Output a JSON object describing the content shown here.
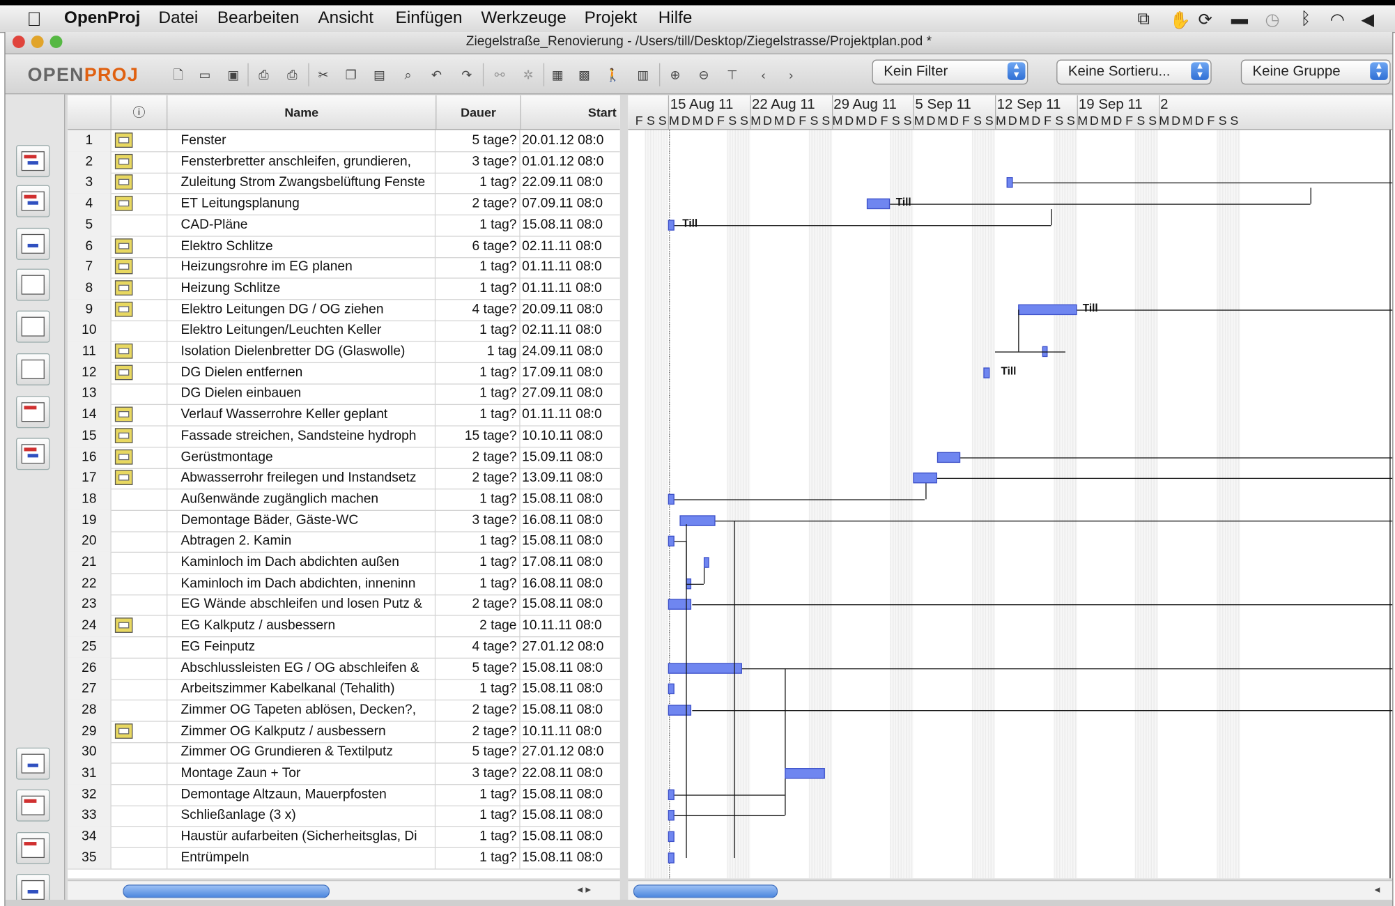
{
  "menubar": {
    "app": "OpenProj",
    "items": [
      "Datei",
      "Bearbeiten",
      "Ansicht",
      "Einfügen",
      "Werkzeuge",
      "Projekt",
      "Hilfe"
    ]
  },
  "window": {
    "title": "Ziegelstraße_Renovierung - /Users/till/Desktop/Ziegelstrasse/Projektplan.pod *"
  },
  "toolbar": {
    "logo_a": "OPEN",
    "logo_b": "PROJ",
    "filter": "Kein Filter",
    "sort": "Keine Sortieru...",
    "group": "Keine Gruppe"
  },
  "grid": {
    "columns": {
      "info": "ⓘ",
      "name": "Name",
      "duration": "Dauer",
      "start": "Start"
    },
    "rows": [
      {
        "id": "1",
        "note": true,
        "name": "Fenster",
        "duration": "5 tage?",
        "start": "20.01.12 08:0"
      },
      {
        "id": "2",
        "note": true,
        "name": "Fensterbretter anschleifen, grundieren,",
        "duration": "3 tage?",
        "start": "01.01.12 08:0"
      },
      {
        "id": "3",
        "note": true,
        "name": "Zuleitung Strom Zwangsbelüftung Fenste",
        "duration": "1 tag?",
        "start": "22.09.11 08:0"
      },
      {
        "id": "4",
        "note": true,
        "name": "ET Leitungsplanung",
        "duration": "2 tage?",
        "start": "07.09.11 08:0"
      },
      {
        "id": "5",
        "note": false,
        "name": "CAD-Pläne",
        "duration": "1 tag?",
        "start": "15.08.11 08:0"
      },
      {
        "id": "6",
        "note": true,
        "name": "Elektro Schlitze",
        "duration": "6 tage?",
        "start": "02.11.11 08:0"
      },
      {
        "id": "7",
        "note": true,
        "name": "Heizungsrohre im EG planen",
        "duration": "1 tag?",
        "start": "01.11.11 08:0"
      },
      {
        "id": "8",
        "note": true,
        "name": "Heizung Schlitze",
        "duration": "1 tag?",
        "start": "01.11.11 08:0"
      },
      {
        "id": "9",
        "note": true,
        "name": "Elektro Leitungen DG / OG ziehen",
        "duration": "4 tage?",
        "start": "20.09.11 08:0"
      },
      {
        "id": "10",
        "note": false,
        "name": "Elektro Leitungen/Leuchten Keller",
        "duration": "1 tag?",
        "start": "02.11.11 08:0"
      },
      {
        "id": "11",
        "note": true,
        "name": "Isolation Dielenbretter DG (Glaswolle)",
        "duration": "1 tag",
        "start": "24.09.11 08:0"
      },
      {
        "id": "12",
        "note": true,
        "name": "DG Dielen entfernen",
        "duration": "1 tag?",
        "start": "17.09.11 08:0"
      },
      {
        "id": "13",
        "note": false,
        "name": "DG Dielen einbauen",
        "duration": "1 tag?",
        "start": "27.09.11 08:0"
      },
      {
        "id": "14",
        "note": true,
        "name": "Verlauf Wasserrohre Keller geplant",
        "duration": "1 tag?",
        "start": "01.11.11 08:0"
      },
      {
        "id": "15",
        "note": true,
        "name": "Fassade streichen, Sandsteine hydroph",
        "duration": "15 tage?",
        "start": "10.10.11 08:0"
      },
      {
        "id": "16",
        "note": true,
        "name": "Gerüstmontage",
        "duration": "2 tage?",
        "start": "15.09.11 08:0"
      },
      {
        "id": "17",
        "note": true,
        "name": "Abwasserrohr freilegen und Instandsetz",
        "duration": "2 tage?",
        "start": "13.09.11 08:0"
      },
      {
        "id": "18",
        "note": false,
        "name": "Außenwände zugänglich machen",
        "duration": "1 tag?",
        "start": "15.08.11 08:0"
      },
      {
        "id": "19",
        "note": false,
        "name": "Demontage Bäder, Gäste-WC",
        "duration": "3 tage?",
        "start": "16.08.11 08:0"
      },
      {
        "id": "20",
        "note": false,
        "name": "Abtragen 2. Kamin",
        "duration": "1 tag?",
        "start": "15.08.11 08:0"
      },
      {
        "id": "21",
        "note": false,
        "name": "Kaminloch im Dach abdichten außen",
        "duration": "1 tag?",
        "start": "17.08.11 08:0"
      },
      {
        "id": "22",
        "note": false,
        "name": "Kaminloch im Dach abdichten, inneninn",
        "duration": "1 tag?",
        "start": "16.08.11 08:0"
      },
      {
        "id": "23",
        "note": false,
        "name": "EG Wände abschleifen und losen Putz &",
        "duration": "2 tage?",
        "start": "15.08.11 08:0"
      },
      {
        "id": "24",
        "note": true,
        "name": "EG Kalkputz / ausbessern",
        "duration": "2 tage",
        "start": "10.11.11 08:0"
      },
      {
        "id": "25",
        "note": false,
        "name": "EG Feinputz",
        "duration": "4 tage?",
        "start": "27.01.12 08:0"
      },
      {
        "id": "26",
        "note": false,
        "name": "Abschlussleisten EG / OG abschleifen &",
        "duration": "5 tage?",
        "start": "15.08.11 08:0"
      },
      {
        "id": "27",
        "note": false,
        "name": "Arbeitszimmer Kabelkanal (Tehalith)",
        "duration": "1 tag?",
        "start": "15.08.11 08:0"
      },
      {
        "id": "28",
        "note": false,
        "name": "Zimmer OG Tapeten ablösen, Decken?,",
        "duration": "2 tage?",
        "start": "15.08.11 08:0"
      },
      {
        "id": "29",
        "note": true,
        "name": "Zimmer OG Kalkputz / ausbessern",
        "duration": "2 tage?",
        "start": "10.11.11 08:0"
      },
      {
        "id": "30",
        "note": false,
        "name": "Zimmer OG Grundieren & Textilputz",
        "duration": "5 tage?",
        "start": "27.01.12 08:0"
      },
      {
        "id": "31",
        "note": false,
        "name": "Montage Zaun + Tor",
        "duration": "3 tage?",
        "start": "22.08.11 08:0"
      },
      {
        "id": "32",
        "note": false,
        "name": "Demontage Altzaun, Mauerpfosten",
        "duration": "1 tag?",
        "start": "15.08.11 08:0"
      },
      {
        "id": "33",
        "note": false,
        "name": " Schließanlage (3 x)",
        "duration": "1 tag?",
        "start": "15.08.11 08:0"
      },
      {
        "id": "34",
        "note": false,
        "name": "Haustür aufarbeiten (Sicherheitsglas, Di",
        "duration": "1 tag?",
        "start": "15.08.11 08:0"
      },
      {
        "id": "35",
        "note": false,
        "name": "Entrümpeln",
        "duration": "1 tag?",
        "start": "15.08.11 08:0"
      }
    ]
  },
  "gantt": {
    "weeks": [
      "15 Aug 11",
      "22 Aug 11",
      "29 Aug 11",
      "5 Sep 11",
      "12 Sep 11",
      "19 Sep 11",
      "2"
    ],
    "lead_days": [
      "F",
      "S",
      "S"
    ],
    "week_days": [
      "M",
      "D",
      "M",
      "D",
      "F",
      "S",
      "S"
    ],
    "resource": "Till"
  }
}
